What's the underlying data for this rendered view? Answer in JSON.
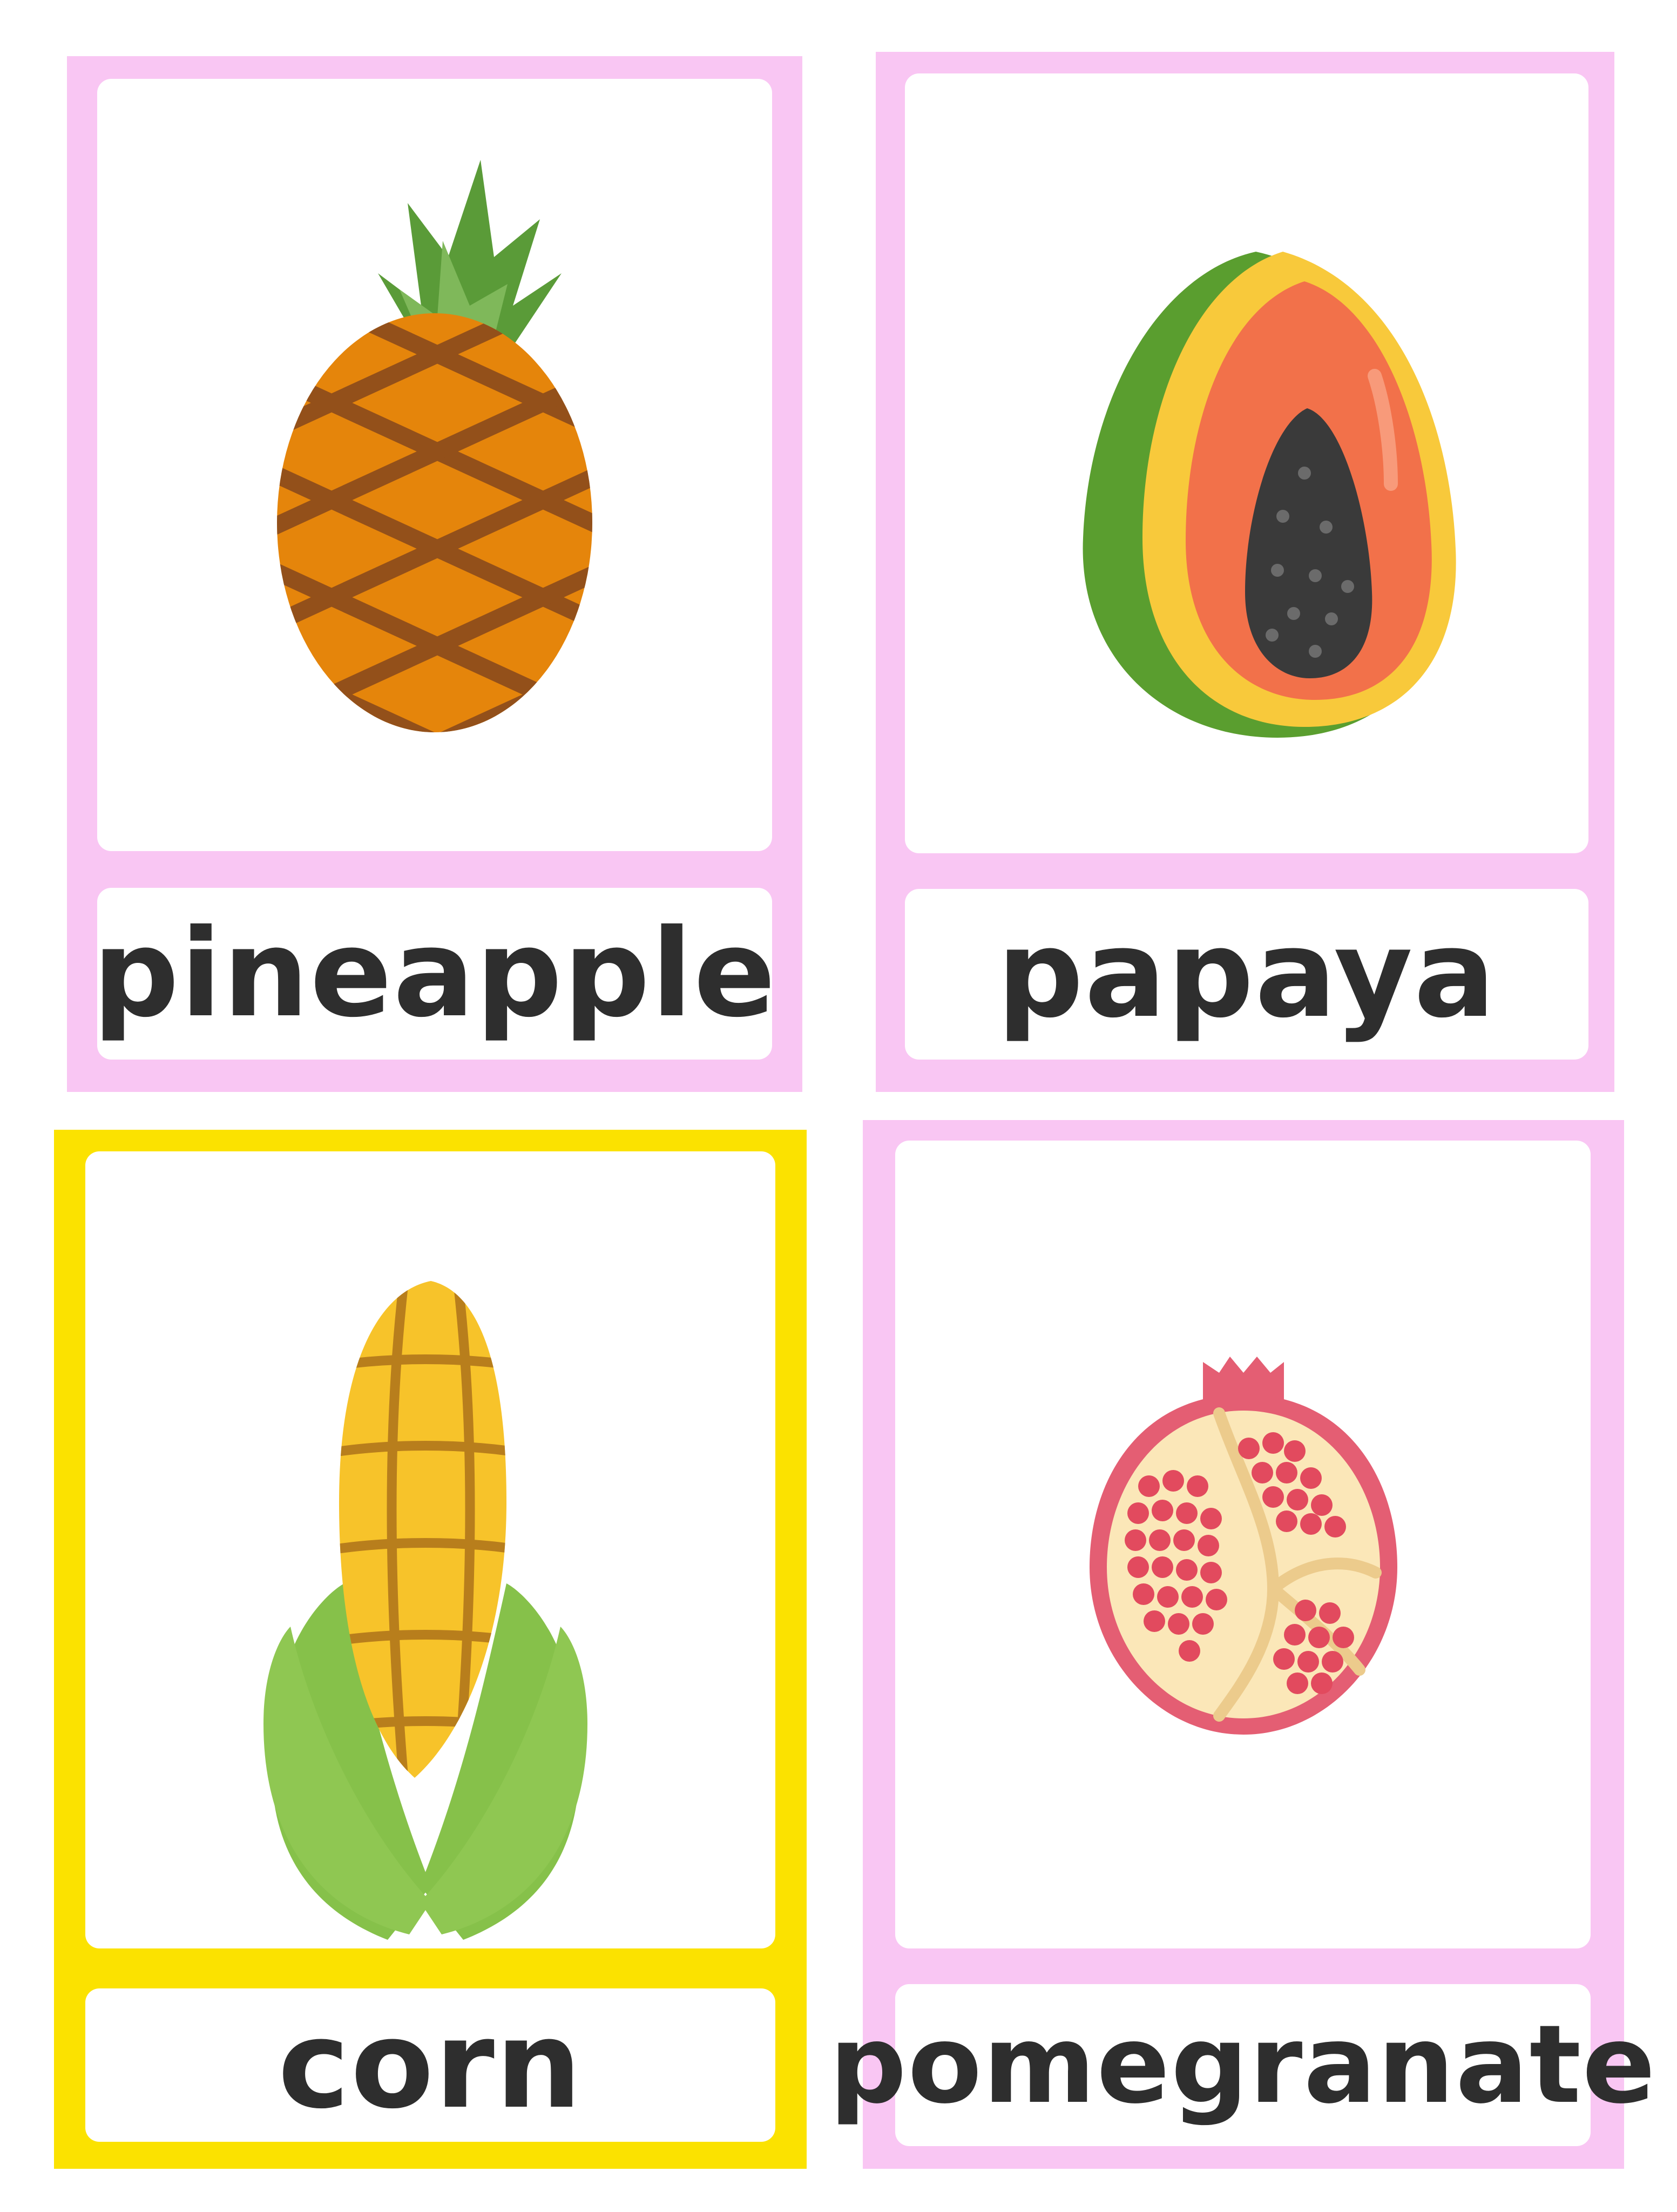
{
  "colors": {
    "pink_frame": "#f9c6f3",
    "yellow_frame": "#fbe200",
    "label_text": "#2e2e2e"
  },
  "cards": [
    {
      "word": "pineapple",
      "icon": "pineapple-icon",
      "frame": "pink"
    },
    {
      "word": "papaya",
      "icon": "papaya-icon",
      "frame": "pink"
    },
    {
      "word": "corn",
      "icon": "corn-icon",
      "frame": "yellow"
    },
    {
      "word": "pomegranate",
      "icon": "pomegranate-icon",
      "frame": "pink"
    }
  ]
}
